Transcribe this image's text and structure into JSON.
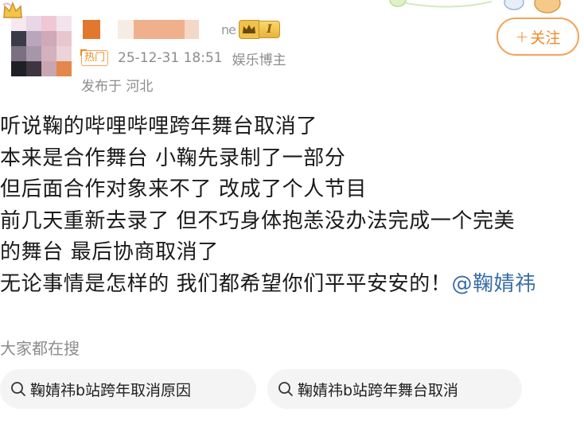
{
  "header": {
    "rank_level": "I",
    "name_suffix": "ne",
    "hot_tag": "热门",
    "timestamp": "25-12-31 18:51",
    "author_role": "娱乐博主",
    "location": "发布于 河北",
    "follow_button": {
      "plus": "+",
      "label": "关注"
    }
  },
  "post": {
    "lines": [
      "听说鞠的哔哩哔哩跨年舞台取消了",
      "本来是合作舞台  小鞠先录制了一部分",
      "但后面合作对象来不了  改成了个人节目",
      "前几天重新去录了  但不巧身体抱恙没办法完成一个完美",
      "的舞台  最后协商取消了",
      "无论事情是怎样的 我们都希望你们平平安安的！"
    ],
    "mention": "@鞠婧祎"
  },
  "search": {
    "title": "大家都在搜",
    "chips": [
      "鞠婧祎b站跨年取消原因",
      "鞠婧祎b站跨年舞台取消"
    ]
  },
  "colors": {
    "accent_orange": "#f08a28",
    "link_blue": "#3a6ea5",
    "meta_gray": "#8c8c8c"
  }
}
